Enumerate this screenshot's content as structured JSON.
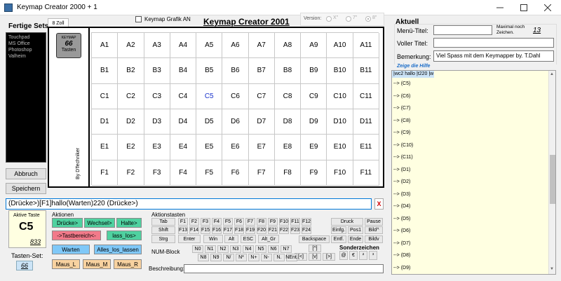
{
  "window": {
    "title": "Keymap Creator 2000 + 1"
  },
  "fertige_sets": {
    "label": "Fertige Sets",
    "items": [
      "Touchpad",
      "MS Office",
      "Photoshop",
      "Valheim"
    ]
  },
  "buttons": {
    "abbruch": "Abbruch",
    "speichern": "Speichern"
  },
  "tab": {
    "label": "8 Zoll"
  },
  "header": {
    "checkbox_label": "Keymap Grafik AN",
    "app_title": "Keymap Creator 2001",
    "version_label": "Version:",
    "versions": [
      "X\"",
      "7\"",
      "8\""
    ]
  },
  "keymap_badge": {
    "top": "KEYMAP",
    "count": "66",
    "bottom": "Tasten"
  },
  "vertical_label": "By DTechniker",
  "grid": {
    "rows": [
      [
        "A1",
        "A2",
        "A3",
        "A4",
        "A5",
        "A6",
        "A7",
        "A8",
        "A9",
        "A10",
        "A11"
      ],
      [
        "B1",
        "B2",
        "B3",
        "B4",
        "B5",
        "B6",
        "B7",
        "B8",
        "B9",
        "B10",
        "B11"
      ],
      [
        "C1",
        "C2",
        "C3",
        "C4",
        "C5",
        "C6",
        "C7",
        "C8",
        "C9",
        "C10",
        "C11"
      ],
      [
        "D1",
        "D2",
        "D3",
        "D4",
        "D5",
        "D6",
        "D7",
        "D8",
        "D9",
        "D10",
        "D11"
      ],
      [
        "E1",
        "E2",
        "E3",
        "E4",
        "E5",
        "E6",
        "E7",
        "E8",
        "E9",
        "E10",
        "E11"
      ],
      [
        "F1",
        "F2",
        "F3",
        "F4",
        "F5",
        "F6",
        "F7",
        "F8",
        "F9",
        "F10",
        "F11"
      ]
    ],
    "active": "C5",
    "active_color": "#1a33cc"
  },
  "macro_input": {
    "value": "(Drücke>)[F1]hallo(Warten)220 (Drücke>)",
    "clear": "X"
  },
  "active_key": {
    "label": "Aktive Taste",
    "value": "C5",
    "code": "833"
  },
  "tasten_set": {
    "label": "Tasten-Set:",
    "value": "66"
  },
  "aktionen": {
    "label": "Aktionen",
    "buttons": [
      {
        "label": "Drücke>",
        "color": "#4fd1a0"
      },
      {
        "label": "Wechsel>",
        "color": "#4fd1a0"
      },
      {
        "label": "Halte>",
        "color": "#4fd1a0"
      },
      {
        "label": "->Tastbereich<-",
        "color": "#f27a8a"
      },
      {
        "label": "lass_los>",
        "color": "#4fd1a0"
      },
      {
        "label": "Warten",
        "color": "#7fc8f8"
      },
      {
        "label": "Alles_los_lassen",
        "color": "#7fc8f8"
      },
      {
        "label": "Maus_L",
        "color": "#f8d2a0"
      },
      {
        "label": "Maus_M",
        "color": "#f8d2a0"
      },
      {
        "label": "Maus_R",
        "color": "#f8d2a0"
      }
    ]
  },
  "aktionstasten": {
    "label": "Aktionstasten",
    "fkeys_row1": [
      "F1",
      "F2",
      "F3",
      "F4",
      "F5",
      "F6",
      "F7",
      "F8",
      "F9",
      "F10",
      "F11",
      "F12"
    ],
    "fkeys_row2": [
      "F13",
      "F14",
      "F15",
      "F16",
      "F17",
      "F18",
      "F19",
      "F20",
      "F21",
      "F22",
      "F23",
      "F24"
    ],
    "tab": "Tab",
    "shift": "Shift",
    "strg": "Strg",
    "row3": [
      "Enter",
      "Win",
      "Alt",
      "ESC",
      "Alt_Gr"
    ],
    "right_keys": [
      "Druck",
      "Pause",
      "Einfg.",
      "Pos1",
      "Bild^",
      "Entf.",
      "Ende",
      "Bildv"
    ],
    "backspace": "Backspace",
    "arrows": [
      "[^]",
      "[<]",
      "[v]",
      "[>]"
    ]
  },
  "numblock": {
    "label": "NUM-Block",
    "row1": [
      "N0",
      "N1",
      "N2",
      "N3",
      "N4",
      "N5",
      "N6",
      "N7"
    ],
    "row2": [
      "N8",
      "N9",
      "N/",
      "N*",
      "N+",
      "N-",
      "N.",
      "NEnt."
    ]
  },
  "sonderzeichen": {
    "label": "Sonderzeichen",
    "chars": [
      "@",
      "€",
      "²",
      "³"
    ]
  },
  "beschreibung": {
    "label": "Beschreibung:",
    "value": ""
  },
  "aktuell": {
    "label": "Aktuell",
    "menu_titel": "Menü-Titel:",
    "menu_value": "",
    "maximal": "Maximal noch Zeichen.",
    "maximal_value": "13",
    "voller_titel": "Voller Titel:",
    "voller_value": "",
    "bemerkung": "Bemerkung:",
    "bemerkung_value": "Viel Spass mit dem Keymapper by. T.Dahl",
    "hilfe": "Zeige die Hilfe"
  },
  "log": {
    "first": "|wc2 hallo |t220 |w",
    "lines": [
      "--> (C5)",
      "--> (C6)",
      "--> (C7)",
      "--> (C8)",
      "--> (C9)",
      "--> (C10)",
      "--> (C11)",
      "--> (D1)",
      "--> (D2)",
      "--> (D3)",
      "--> (D4)",
      "--> (D5)",
      "--> (D6)",
      "--> (D7)",
      "--> (D8)",
      "--> (D9)"
    ]
  }
}
